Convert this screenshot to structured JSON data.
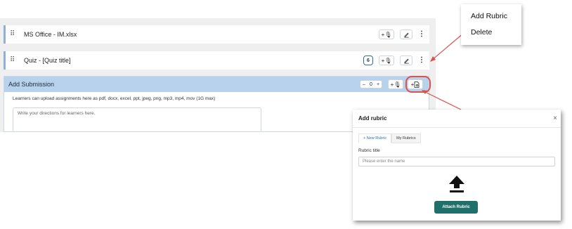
{
  "rows": [
    {
      "title": "MS Office - IM.xlsx",
      "add_label": "+🎙",
      "edit_icon": "pencil-icon",
      "more_icon": "kebab-icon"
    },
    {
      "title": "Quiz - [Quiz title]",
      "count": "6",
      "add_label": "+🎙",
      "edit_icon": "pencil-icon",
      "more_icon": "kebab-icon"
    }
  ],
  "submission": {
    "title": "Add Submission",
    "stepper": {
      "minus": "–",
      "value": "0",
      "plus": "+"
    },
    "add_label": "+🎙",
    "rubric_label": "+",
    "description": "Learners can upload assignments here as pdf, docx, excel, ppt, jpeg, png, mp3, mp4, mov (1G max)",
    "directions_placeholder": "Write your directions for learners here."
  },
  "context_menu": {
    "items": [
      "Add Rubric",
      "Delete"
    ]
  },
  "modal": {
    "title": "Add rubric",
    "close": "×",
    "tabs": [
      "+ New Rubric",
      "My Rubrics"
    ],
    "field_label": "Rubric title",
    "field_placeholder": "Please enter the name",
    "button": "Attach Rubric"
  },
  "colors": {
    "accent_red": "#d9534f",
    "header_blue": "#b8d1ec",
    "row_border": "#8fb1d9",
    "attach_button": "#1f6f6a"
  }
}
